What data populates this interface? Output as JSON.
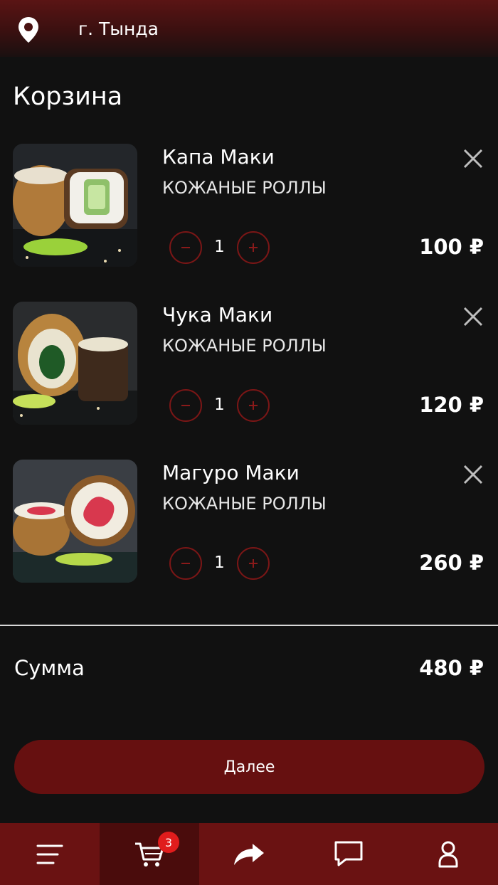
{
  "header": {
    "city": "г. Тында",
    "icon": "location-pin-icon"
  },
  "page": {
    "title": "Корзина"
  },
  "cart": {
    "items": [
      {
        "name": "Капа Маки",
        "category": "КОЖАНЫЕ РОЛЛЫ",
        "quantity": "1",
        "price": "100 ₽"
      },
      {
        "name": "Чука Маки",
        "category": "КОЖАНЫЕ РОЛЛЫ",
        "quantity": "1",
        "price": "120 ₽"
      },
      {
        "name": "Магуро Маки",
        "category": "КОЖАНЫЕ РОЛЛЫ",
        "quantity": "1",
        "price": "260 ₽"
      }
    ]
  },
  "summary": {
    "label": "Сумма",
    "total": "480 ₽"
  },
  "actions": {
    "next_label": "Далее"
  },
  "nav": {
    "items": [
      {
        "icon": "menu-icon"
      },
      {
        "icon": "cart-icon",
        "badge": "3"
      },
      {
        "icon": "share-icon"
      },
      {
        "icon": "chat-icon"
      },
      {
        "icon": "profile-icon"
      }
    ]
  },
  "colors": {
    "accent": "#661010",
    "nav": "#6a1212",
    "badge": "#e01c1c",
    "background": "#111111"
  }
}
